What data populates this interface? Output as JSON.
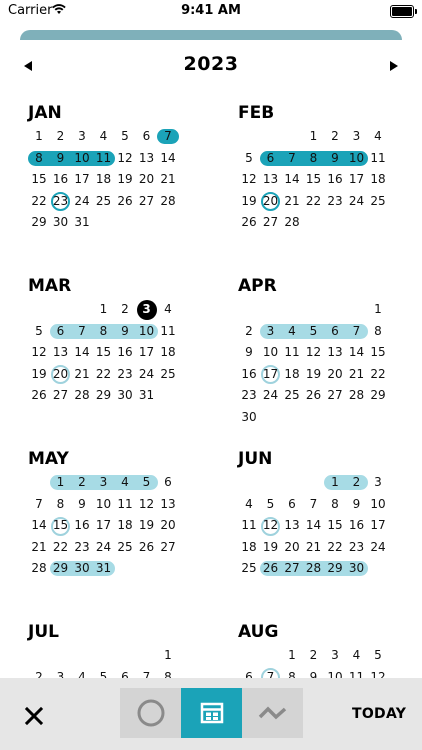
{
  "status_bar": {
    "carrier": "Carrier",
    "time": "9:41 AM"
  },
  "header": {
    "year": "2023"
  },
  "toolbar": {
    "today_label": "TODAY"
  },
  "colors": {
    "accent": "#1ba3b8",
    "accent_light": "#a7dbe5",
    "ring_light": "#9fd2dd",
    "toolbar_bg": "#e6e6e6",
    "segment_bg": "#d4d4d4"
  },
  "icons": {
    "prev": "triangle-left-icon",
    "next": "triangle-right-icon",
    "close": "close-x-icon",
    "circle_view": "circle-icon",
    "calendar_view": "calendar-grid-icon",
    "trend_view": "trend-zigzag-icon",
    "wifi": "wifi-icon",
    "battery": "battery-icon"
  },
  "months": [
    {
      "name": "JAN",
      "start": 0,
      "days": 31,
      "ranges": [
        {
          "from": 7,
          "to": 7,
          "style": "dark"
        },
        {
          "from": 8,
          "to": 11,
          "style": "dark"
        }
      ],
      "rings": [
        {
          "day": 23,
          "style": "dark"
        }
      ],
      "dots": []
    },
    {
      "name": "FEB",
      "start": 3,
      "days": 28,
      "ranges": [
        {
          "from": 6,
          "to": 10,
          "style": "dark"
        }
      ],
      "rings": [
        {
          "day": 20,
          "style": "dark"
        }
      ],
      "dots": []
    },
    {
      "name": "MAR",
      "start": 3,
      "days": 31,
      "ranges": [
        {
          "from": 6,
          "to": 10,
          "style": "light"
        }
      ],
      "rings": [
        {
          "day": 20,
          "style": "light"
        }
      ],
      "dots": [
        3
      ]
    },
    {
      "name": "APR",
      "start": 6,
      "days": 30,
      "ranges": [
        {
          "from": 3,
          "to": 7,
          "style": "light"
        }
      ],
      "rings": [
        {
          "day": 17,
          "style": "light"
        }
      ],
      "dots": []
    },
    {
      "name": "MAY",
      "start": 1,
      "days": 31,
      "ranges": [
        {
          "from": 1,
          "to": 5,
          "style": "light"
        },
        {
          "from": 29,
          "to": 31,
          "style": "light"
        }
      ],
      "rings": [
        {
          "day": 15,
          "style": "light"
        }
      ],
      "dots": []
    },
    {
      "name": "JUN",
      "start": 4,
      "days": 30,
      "ranges": [
        {
          "from": 1,
          "to": 2,
          "style": "light"
        },
        {
          "from": 26,
          "to": 30,
          "style": "light"
        }
      ],
      "rings": [
        {
          "day": 12,
          "style": "light"
        }
      ],
      "dots": []
    },
    {
      "name": "JUL",
      "start": 6,
      "days": 31,
      "ranges": [],
      "rings": [],
      "dots": []
    },
    {
      "name": "AUG",
      "start": 2,
      "days": 31,
      "ranges": [],
      "rings": [
        {
          "day": 7,
          "style": "light"
        }
      ],
      "dots": []
    }
  ]
}
